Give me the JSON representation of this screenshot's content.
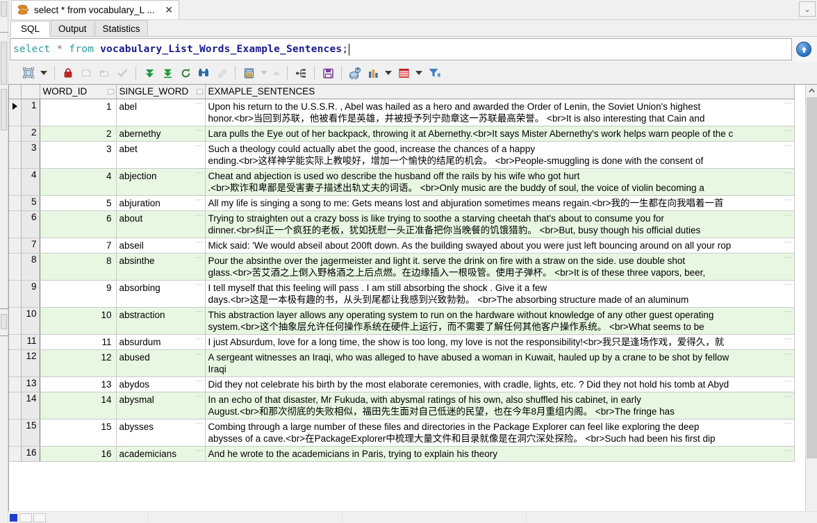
{
  "window": {
    "tab_title": "select * from vocabulary_L ...",
    "tab_icon": "database-icon",
    "close_label": "✕",
    "overflow_label": "⌄"
  },
  "subtabs": [
    {
      "label": "SQL",
      "active": true
    },
    {
      "label": "Output",
      "active": false
    },
    {
      "label": "Statistics",
      "active": false
    }
  ],
  "editor": {
    "kw_select": "select",
    "star": "*",
    "kw_from": "from",
    "table": "vocabulary_List_Words_Example_Sentences",
    "semicolon": ";",
    "run_icon": "run-arrow-up-icon",
    "colors": {
      "keyword": "#2e9a9a",
      "table": "#1a1a8c",
      "star": "#7a7a7a"
    }
  },
  "toolbar": [
    {
      "name": "grid-view-icon",
      "enabled": true
    },
    {
      "name": "grid-view-dropdown-icon",
      "enabled": true
    },
    {
      "name": "lock-icon",
      "enabled": true
    },
    {
      "name": "insert-row-icon",
      "enabled": false
    },
    {
      "name": "delete-row-icon",
      "enabled": false
    },
    {
      "name": "commit-check-icon",
      "enabled": false
    },
    {
      "name": "export-down-icon",
      "enabled": true
    },
    {
      "name": "fetch-all-down-icon",
      "enabled": true
    },
    {
      "name": "refresh-icon",
      "enabled": true
    },
    {
      "name": "find-binoculars-icon",
      "enabled": true
    },
    {
      "name": "eraser-icon",
      "enabled": false
    },
    {
      "name": "calculate-icon",
      "enabled": true
    },
    {
      "name": "sort-descending-icon",
      "enabled": false
    },
    {
      "name": "sort-ascending-icon",
      "enabled": false
    },
    {
      "name": "hierarchy-icon",
      "enabled": true
    },
    {
      "name": "save-floppy-icon",
      "enabled": true
    },
    {
      "name": "import-data-icon",
      "enabled": true
    },
    {
      "name": "bar-chart-icon",
      "enabled": true
    },
    {
      "name": "bar-chart-dropdown-icon",
      "enabled": true
    },
    {
      "name": "table-grid-icon",
      "enabled": true
    },
    {
      "name": "table-grid-dropdown-icon",
      "enabled": true
    },
    {
      "name": "filter-icon",
      "enabled": true
    }
  ],
  "grid": {
    "columns": [
      "WORD_ID",
      "SINGLE_WORD",
      "EXMAPLE_SENTENCES"
    ],
    "cell_menu_glyph": "⋯",
    "rows": [
      {
        "num": "1",
        "selected": true,
        "id": "1",
        "word": "abel",
        "sentence": [
          "Upon his return to the U.S.S.R. , Abel was hailed as a hero and awarded the Order of Lenin, the Soviet Union's highest",
          "honor.<br>当回到苏联，他被看作是英雄，并被授予列宁勋章这一苏联最高荣誉。 <br>It is also interesting that Cain and"
        ]
      },
      {
        "num": "2",
        "selected": false,
        "id": "2",
        "word": "abernethy",
        "sentence": [
          "Lara pulls the Eye out of her backpack, throwing it at Abernethy.<br>It says Mister Abernethy's work helps warn people of the c"
        ]
      },
      {
        "num": "3",
        "selected": false,
        "id": "3",
        "word": "abet",
        "sentence": [
          "Such a theology could actually abet the good, increase the chances of a happy",
          "ending.<br>这样神学能实际上教唆好，增加一个愉快的结尾的机会。 <br>People-smuggling is done with the consent of"
        ]
      },
      {
        "num": "4",
        "selected": false,
        "id": "4",
        "word": "abjection",
        "sentence": [
          "Cheat and abjection is used wo describe the husband off the rails by his wife who got hurt",
          ".<br>欺诈和卑鄙是受害妻子描述出轨丈夫的词语。 <br>Only music are the buddy of soul, the voice of violin becoming a"
        ]
      },
      {
        "num": "5",
        "selected": false,
        "id": "5",
        "word": "abjuration",
        "sentence": [
          "All my life is singing a song to me: Gets means lost and abjuration sometimes means regain.<br>我的一生都在向我唱着一首"
        ]
      },
      {
        "num": "6",
        "selected": false,
        "id": "6",
        "word": "about",
        "sentence": [
          "Trying to straighten out a crazy boss is like trying to soothe a starving cheetah that's about to consume you for",
          "dinner.<br>纠正一个疯狂的老板，犹如抚慰一头正准备把你当晚餐的饥饿猎豹。 <br>But, busy though his official duties"
        ]
      },
      {
        "num": "7",
        "selected": false,
        "id": "7",
        "word": "abseil",
        "sentence": [
          "Mick said: 'We would abseil about 200ft down. As the building swayed about you were just left bouncing around on all your rop"
        ]
      },
      {
        "num": "8",
        "selected": false,
        "id": "8",
        "word": "absinthe",
        "sentence": [
          "Pour the absinthe over the jagermeister and light it. serve the drink on fire with a straw on the side. use double shot",
          "glass.<br>苦艾酒之上倒入野格酒之上后点燃。在边缘插入一根吸管。使用子弹杯。 <br>It is of these three vapors, beer,"
        ]
      },
      {
        "num": "9",
        "selected": false,
        "id": "9",
        "word": "absorbing",
        "sentence": [
          "I tell myself that this feeling will pass . I am still absorbing the shock . Give it a few",
          "days.<br>这是一本极有趣的书，从头到尾都让我感到兴致勃勃。 <br>The absorbing structure made of an aluminum"
        ]
      },
      {
        "num": "10",
        "selected": false,
        "id": "10",
        "word": "abstraction",
        "sentence": [
          "This abstraction layer allows any operating system to run on the hardware without knowledge of any other guest operating",
          "system.<br>这个抽象层允许任何操作系统在硬件上运行，而不需要了解任何其他客户操作系统。 <br>What seems to be"
        ]
      },
      {
        "num": "11",
        "selected": false,
        "id": "11",
        "word": "absurdum",
        "sentence": [
          "I just Absurdum, love for a long time, the show is too long, my love is not the responsibility!<br>我只是逢场作戏，爱得久，就"
        ]
      },
      {
        "num": "12",
        "selected": false,
        "id": "12",
        "word": "abused",
        "sentence": [
          "A sergeant witnesses an Iraqi, who was alleged to have abused a woman in Kuwait, hauled up by a crane to be shot by fellow",
          "Iraqi"
        ]
      },
      {
        "num": "13",
        "selected": false,
        "id": "13",
        "word": "abydos",
        "sentence": [
          "Did they not celebrate his birth by the most elaborate ceremonies, with cradle, lights, etc. ? Did they not hold his tomb at Abyd"
        ]
      },
      {
        "num": "14",
        "selected": false,
        "id": "14",
        "word": "abysmal",
        "sentence": [
          "In an echo of that disaster, Mr Fukuda, with abysmal ratings of his own, also shuffled his cabinet, in early",
          "August.<br>和那次彻底的失败相似，福田先生面对自己低迷的民望，也在今年8月重组内阁。 <br>The fringe has"
        ]
      },
      {
        "num": "15",
        "selected": false,
        "id": "15",
        "word": "abysses",
        "sentence": [
          "Combing through a large number of these files and directories in the Package Explorer can feel like exploring the deep",
          "abysses of a cave.<br>在PackageExplorer中梳理大量文件和目录就像是在洞穴深处探险。 <br>Such had been his first dip"
        ]
      },
      {
        "num": "16",
        "selected": false,
        "id": "16",
        "word": "academicians",
        "sentence": [
          "And he wrote to the academicians in Paris, trying to explain his theory"
        ]
      }
    ]
  },
  "scrollbars": {
    "vertical_up_glyph": "⌃",
    "horizontal_marker": "scroll-marker"
  }
}
